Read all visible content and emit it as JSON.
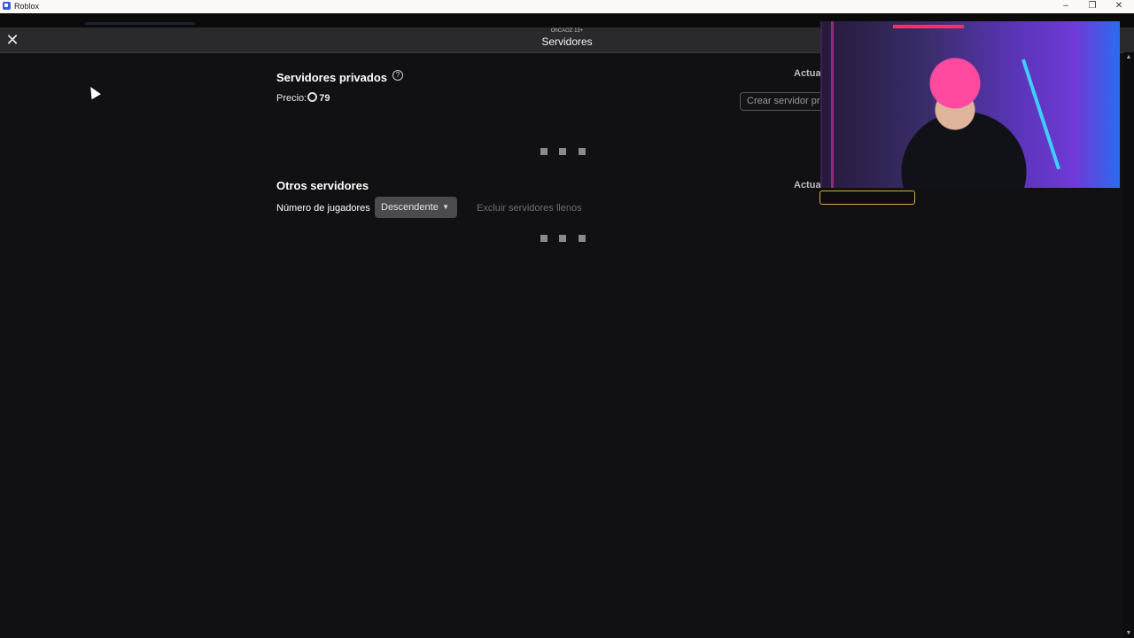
{
  "window": {
    "app_name": "Roblox",
    "controls": {
      "minimize": "–",
      "restore": "❐",
      "close": "✕"
    }
  },
  "header": {
    "subtitle": "OhCAOZ 13+",
    "title": "Servidores",
    "close_icon": "✕"
  },
  "private_servers": {
    "title": "Servidores privados",
    "help_icon": "?",
    "price_label": "Precio:",
    "price_amount": "79",
    "refresh_label": "Actual",
    "create_button": "Crear servidor pri"
  },
  "other_servers": {
    "title": "Otros servidores",
    "refresh_label": "Actual",
    "sort_label": "Número de jugadores",
    "sort_selected": "Descendente",
    "exclude_full_label": "Excluir servidores llenos"
  },
  "icons": {
    "close": "close-icon",
    "help": "help-circle-icon",
    "robux": "robux-icon",
    "chevron": "chevron-down-icon"
  },
  "colors": {
    "background": "#111113",
    "header": "#2a2a2d",
    "select_bg": "#4b4b4f",
    "muted_text": "#6f6f6f"
  }
}
